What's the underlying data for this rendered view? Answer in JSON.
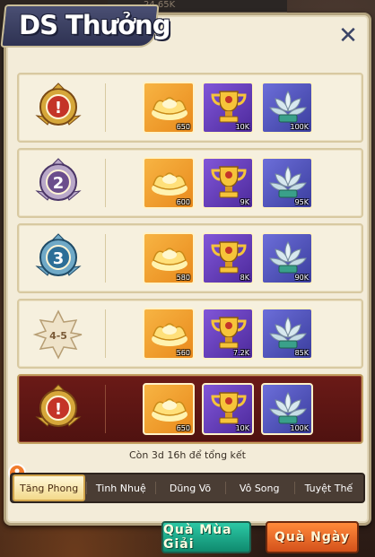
{
  "app": {
    "title": "DS Thưởng",
    "top_ghost_value": "24.65K"
  },
  "colors": {
    "accent_gold": "#f3d98a",
    "current_row": "#6b1a17",
    "title_plate": "#3b4466"
  },
  "rows": [
    {
      "rank_label": "1",
      "rank_icon": "rank-1-gold-medal-icon",
      "items": [
        {
          "icon": "gold-ingot-icon",
          "qty": "650"
        },
        {
          "icon": "gold-trophy-icon",
          "qty": "10K"
        },
        {
          "icon": "silver-lotus-icon",
          "qty": "100K"
        }
      ]
    },
    {
      "rank_label": "2",
      "rank_icon": "rank-2-silver-medal-icon",
      "items": [
        {
          "icon": "gold-ingot-icon",
          "qty": "600"
        },
        {
          "icon": "gold-trophy-icon",
          "qty": "9K"
        },
        {
          "icon": "silver-lotus-icon",
          "qty": "95K"
        }
      ]
    },
    {
      "rank_label": "3",
      "rank_icon": "rank-3-bronze-medal-icon",
      "items": [
        {
          "icon": "gold-ingot-icon",
          "qty": "580"
        },
        {
          "icon": "gold-trophy-icon",
          "qty": "8K"
        },
        {
          "icon": "silver-lotus-icon",
          "qty": "90K"
        }
      ]
    },
    {
      "rank_label": "4-5",
      "rank_icon": "rank-4-5-badge-icon",
      "items": [
        {
          "icon": "gold-ingot-icon",
          "qty": "560"
        },
        {
          "icon": "gold-trophy-icon",
          "qty": "7.2K"
        },
        {
          "icon": "silver-lotus-icon",
          "qty": "85K"
        }
      ]
    },
    {
      "rank_label": "1",
      "rank_icon": "rank-1-gold-medal-icon",
      "current": true,
      "items": [
        {
          "icon": "gold-ingot-icon",
          "qty": "650"
        },
        {
          "icon": "gold-trophy-icon",
          "qty": "10K"
        },
        {
          "icon": "silver-lotus-icon",
          "qty": "100K"
        }
      ]
    }
  ],
  "status_text": "Còn 3d 16h để tổng kết",
  "tabs": [
    {
      "label": "Tăng Phong",
      "active": true
    },
    {
      "label": "Tinh Nhuệ"
    },
    {
      "label": "Dũng Võ"
    },
    {
      "label": "Vô Song"
    },
    {
      "label": "Tuyệt Thế"
    }
  ],
  "buttons": {
    "season": "Quà Mùa Giải",
    "daily": "Quà Ngày"
  }
}
